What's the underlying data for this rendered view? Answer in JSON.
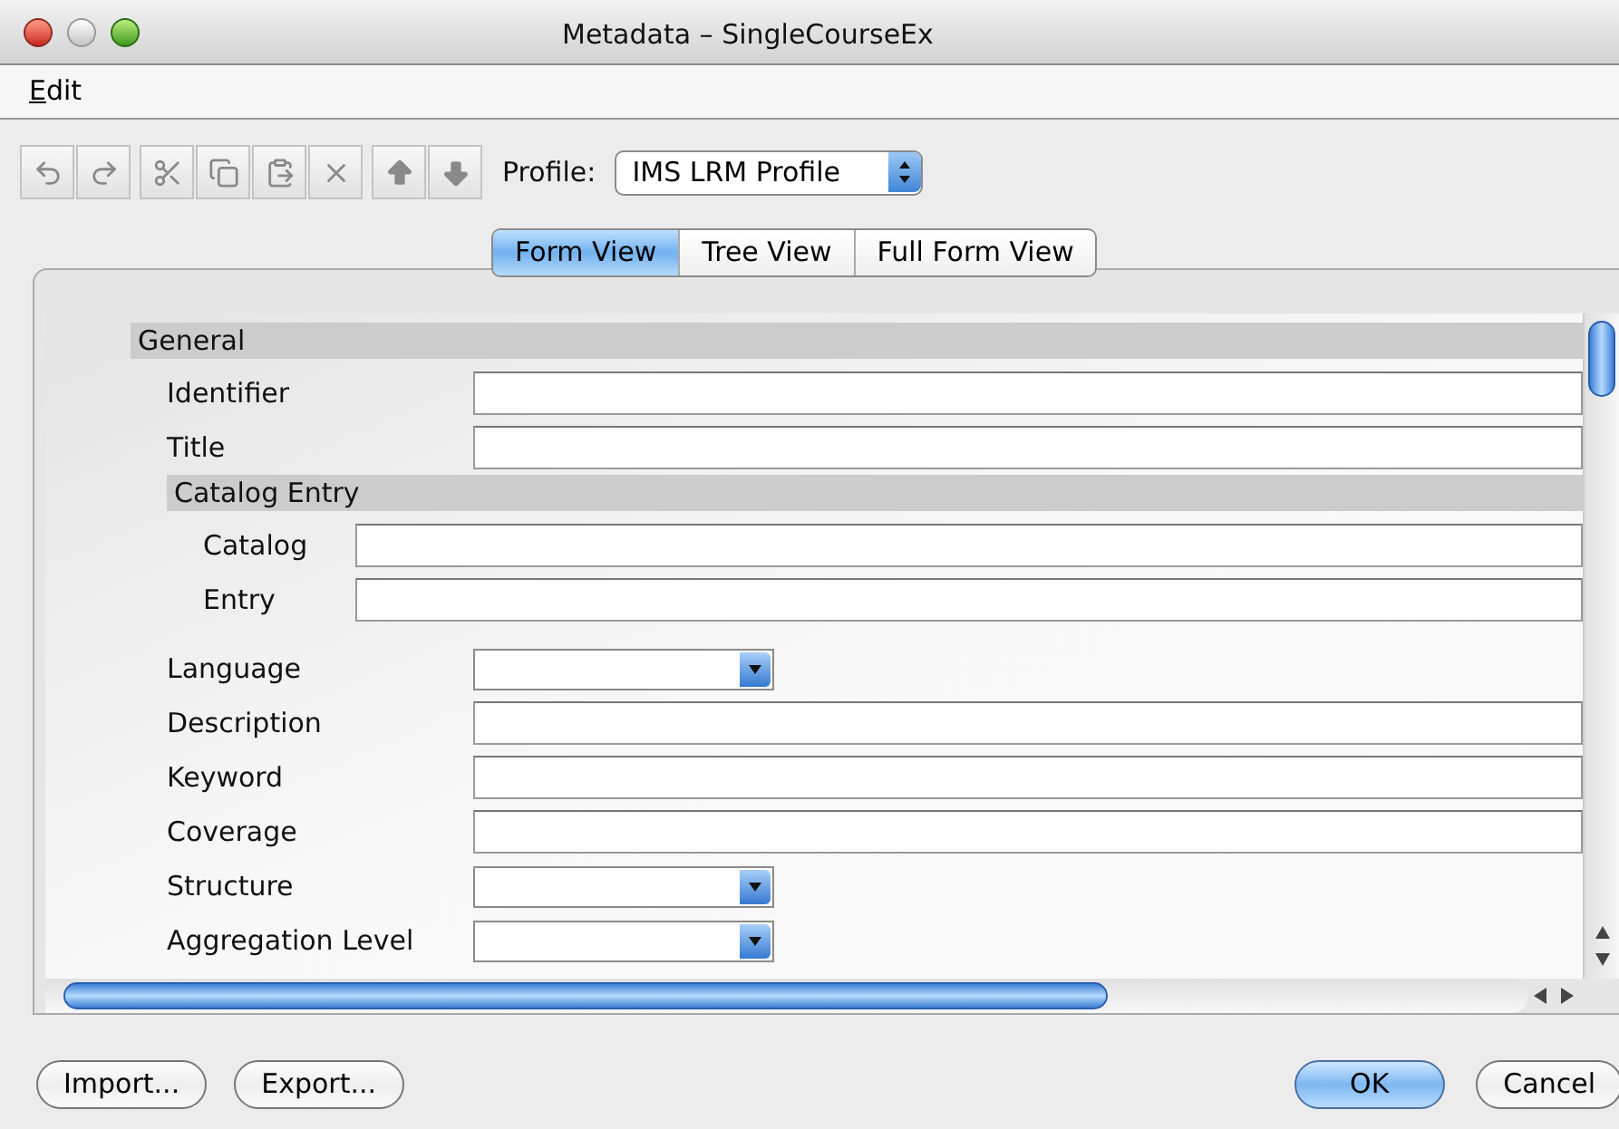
{
  "window": {
    "title": "Metadata – SingleCourseEx"
  },
  "menu": [
    {
      "mnemonic": "E",
      "rest": "dit"
    }
  ],
  "profile": {
    "label": "Profile:",
    "value": "IMS LRM Profile"
  },
  "tabs": [
    {
      "label": "Form View",
      "selected": true
    },
    {
      "label": "Tree View",
      "selected": false
    },
    {
      "label": "Full Form View",
      "selected": false
    }
  ],
  "form": [
    {
      "kind": "section",
      "label": "General",
      "children": [
        {
          "kind": "text",
          "label": "Identifier"
        },
        {
          "kind": "text",
          "label": "Title"
        },
        {
          "kind": "section",
          "label": "Catalog Entry",
          "children": [
            {
              "kind": "text",
              "label": "Catalog"
            },
            {
              "kind": "text",
              "label": "Entry"
            }
          ]
        },
        {
          "kind": "dropdown",
          "label": "Language"
        },
        {
          "kind": "text",
          "label": "Description"
        },
        {
          "kind": "text",
          "label": "Keyword"
        },
        {
          "kind": "text",
          "label": "Coverage"
        },
        {
          "kind": "dropdown",
          "label": "Structure"
        },
        {
          "kind": "dropdown",
          "label": "Aggregation Level"
        }
      ]
    }
  ],
  "left_buttons": [
    {
      "label": "Import...",
      "default": false
    },
    {
      "label": "Export...",
      "default": false
    }
  ],
  "right_buttons": [
    {
      "label": "OK",
      "default": true
    },
    {
      "label": "Cancel",
      "default": false
    }
  ]
}
